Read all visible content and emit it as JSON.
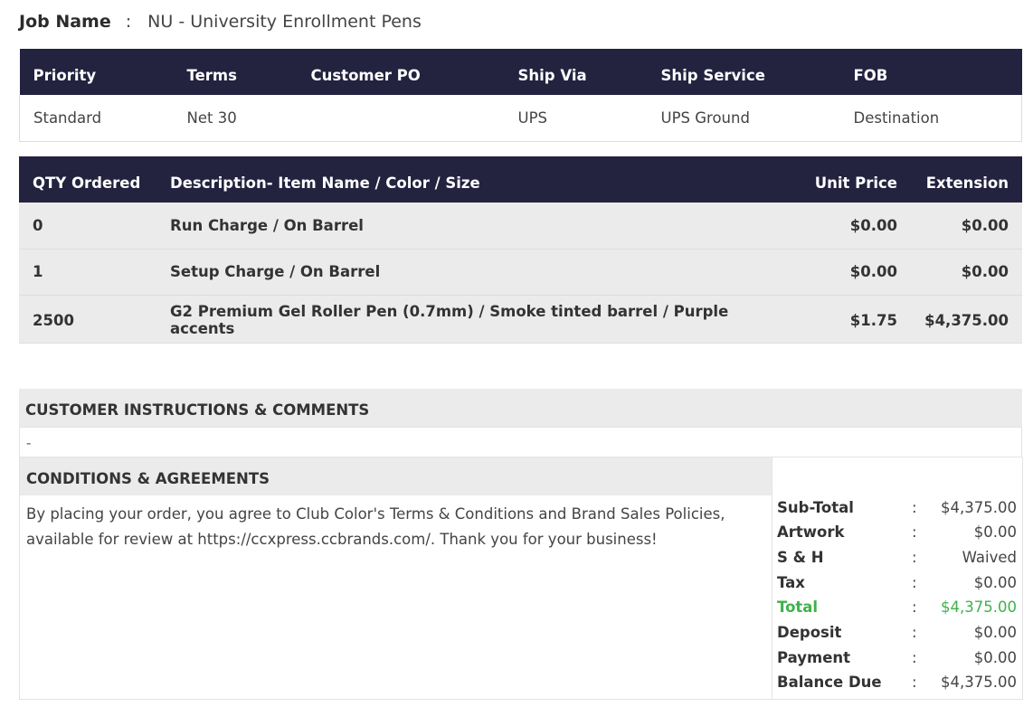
{
  "job": {
    "label": "Job Name",
    "colon": ":",
    "value": "NU - University Enrollment Pens"
  },
  "order_info": {
    "headers": [
      "Priority",
      "Terms",
      "Customer PO",
      "Ship Via",
      "Ship Service",
      "FOB"
    ],
    "values": [
      "Standard",
      "Net 30",
      "",
      "UPS",
      "UPS Ground",
      "Destination"
    ]
  },
  "items": {
    "headers": {
      "qty": "QTY Ordered",
      "description": "Description- Item Name / Color / Size",
      "unit_price": "Unit Price",
      "extension": "Extension"
    },
    "rows": [
      {
        "qty": "0",
        "description": "Run Charge / On Barrel",
        "unit_price": "$0.00",
        "extension": "$0.00"
      },
      {
        "qty": "1",
        "description": "Setup Charge / On Barrel",
        "unit_price": "$0.00",
        "extension": "$0.00"
      },
      {
        "qty": "2500",
        "description": "G2 Premium Gel Roller Pen (0.7mm) / Smoke tinted barrel / Purple accents",
        "unit_price": "$1.75",
        "extension": "$4,375.00"
      }
    ]
  },
  "customer_instructions": {
    "title": "CUSTOMER INSTRUCTIONS & COMMENTS",
    "text": "-"
  },
  "conditions": {
    "title": "CONDITIONS & AGREEMENTS",
    "text": "By placing your order, you agree to Club Color's Terms & Conditions and Brand Sales Policies, available for review at https://ccxpress.ccbrands.com/. Thank you for your business!"
  },
  "totals": {
    "colon": ":",
    "subtotal": {
      "label": "Sub-Total",
      "value": "$4,375.00"
    },
    "artwork": {
      "label": "Artwork",
      "value": "$0.00"
    },
    "sh": {
      "label": "S & H",
      "value": "Waived"
    },
    "tax": {
      "label": "Tax",
      "value": "$0.00"
    },
    "total": {
      "label": "Total",
      "value": "$4,375.00"
    },
    "deposit": {
      "label": "Deposit",
      "value": "$0.00"
    },
    "payment": {
      "label": "Payment",
      "value": "$0.00"
    },
    "balance_due": {
      "label": "Balance Due",
      "value": "$4,375.00"
    }
  },
  "colors": {
    "header_bg": "#23223f",
    "total_green": "#3fb24a",
    "row_bg": "#ebebeb"
  }
}
